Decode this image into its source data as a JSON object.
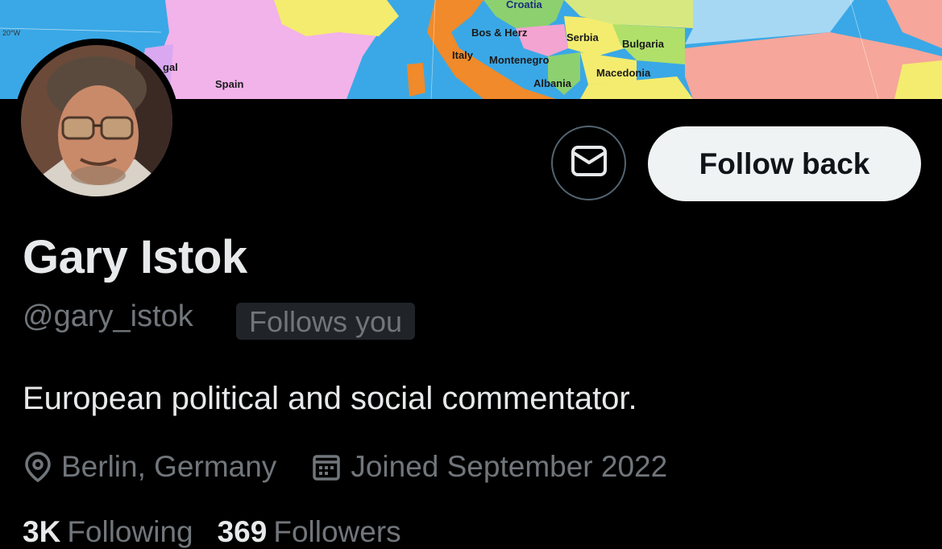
{
  "banner": {
    "map_labels": {
      "croatia": "Croatia",
      "bos_herz": "Bos & Herz",
      "serbia": "Serbia",
      "bulgaria": "Bulgaria",
      "italy": "Italy",
      "montenegro": "Montenegro",
      "macedonia": "Macedonia",
      "albania": "Albania",
      "spain": "Spain",
      "portugal_partial": "gal",
      "longitude": "20°W"
    }
  },
  "profile": {
    "display_name": "Gary Istok",
    "handle": "@gary_istok",
    "follows_you_badge": "Follows you",
    "bio": "European political and social commentator.",
    "location": "Berlin, Germany",
    "joined": "Joined September 2022"
  },
  "actions": {
    "follow_back_label": "Follow back",
    "message_icon": "envelope-icon"
  },
  "stats": {
    "following_count": "3K",
    "following_label": "Following",
    "followers_count": "369",
    "followers_label": "Followers"
  },
  "colors": {
    "background": "#000000",
    "primary_text": "#e7e9ea",
    "secondary_text": "#71767b",
    "button_bg": "#eff3f4",
    "button_text": "#0f1419",
    "badge_bg": "#202327",
    "border": "#536471"
  }
}
